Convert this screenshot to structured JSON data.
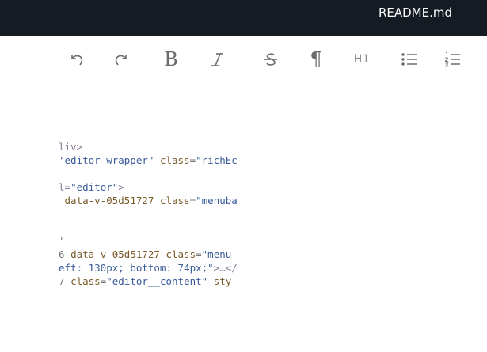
{
  "window": {
    "file_title": "README.md"
  },
  "toolbar": {
    "buttons": [
      {
        "name": "undo",
        "icon": "undo-icon"
      },
      {
        "name": "redo",
        "icon": "redo-icon"
      },
      {
        "name": "bold",
        "icon": "bold-icon",
        "glyph": "B"
      },
      {
        "name": "italic",
        "icon": "italic-icon"
      },
      {
        "name": "strikethrough",
        "icon": "strikethrough-icon"
      },
      {
        "name": "paragraph",
        "icon": "paragraph-icon",
        "glyph": "¶"
      },
      {
        "name": "heading-1",
        "icon": "heading-1-icon",
        "glyph": "H1"
      },
      {
        "name": "bullet-list",
        "icon": "bullet-list-icon"
      },
      {
        "name": "ordered-list",
        "icon": "ordered-list-icon"
      }
    ]
  },
  "code_lines": [
    {
      "parts": [
        {
          "cls": "tok-tag",
          "text": "liv>"
        }
      ]
    },
    {
      "parts": [
        {
          "cls": "tok-val",
          "text": "'editor-wrapper\""
        },
        {
          "cls": "tok-text",
          "text": " "
        },
        {
          "cls": "tok-attr",
          "text": "class"
        },
        {
          "cls": "tok-text",
          "text": "="
        },
        {
          "cls": "tok-val",
          "text": "\"richEc"
        }
      ]
    },
    {
      "parts": []
    },
    {
      "parts": [
        {
          "cls": "tok-tag",
          "text": "l="
        },
        {
          "cls": "tok-val",
          "text": "\"editor\""
        },
        {
          "cls": "tok-tag",
          "text": ">"
        }
      ]
    },
    {
      "parts": [
        {
          "cls": "tok-text",
          "text": " "
        },
        {
          "cls": "tok-attr",
          "text": "data-v-05d51727"
        },
        {
          "cls": "tok-text",
          "text": " "
        },
        {
          "cls": "tok-attr",
          "text": "class"
        },
        {
          "cls": "tok-text",
          "text": "="
        },
        {
          "cls": "tok-val",
          "text": "\"menuba"
        }
      ]
    },
    {
      "parts": []
    },
    {
      "parts": []
    },
    {
      "parts": [
        {
          "cls": "tok-text",
          "text": "'"
        }
      ]
    },
    {
      "parts": [
        {
          "cls": "tok-text",
          "text": "6 "
        },
        {
          "cls": "tok-attr",
          "text": "data-v-05d51727"
        },
        {
          "cls": "tok-text",
          "text": " "
        },
        {
          "cls": "tok-attr",
          "text": "class"
        },
        {
          "cls": "tok-text",
          "text": "="
        },
        {
          "cls": "tok-val",
          "text": "\"menu"
        }
      ]
    },
    {
      "parts": [
        {
          "cls": "tok-val",
          "text": "eft: 130px; bottom: 74px;\""
        },
        {
          "cls": "tok-tag",
          "text": ">…</"
        }
      ]
    },
    {
      "parts": [
        {
          "cls": "tok-text",
          "text": "7 "
        },
        {
          "cls": "tok-attr",
          "text": "class"
        },
        {
          "cls": "tok-text",
          "text": "="
        },
        {
          "cls": "tok-val",
          "text": "\"editor__content\""
        },
        {
          "cls": "tok-text",
          "text": " "
        },
        {
          "cls": "tok-attr",
          "text": "sty"
        }
      ]
    }
  ]
}
